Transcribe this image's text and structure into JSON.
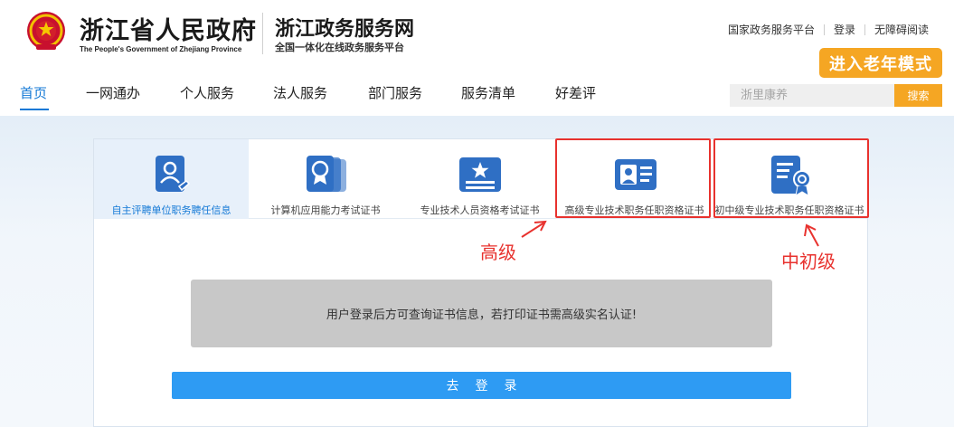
{
  "header": {
    "gov_name": "浙江省人民政府",
    "gov_name_en": "The People's Government of Zhejiang Province",
    "site_name": "浙江政务服务网",
    "site_subtitle": "全国一体化在线政务服务平台",
    "emblem_icon": "national-emblem-icon",
    "top_links": [
      "国家政务服务平台",
      "登录",
      "无障碍阅读"
    ],
    "elder_mode_label": "进入老年模式"
  },
  "nav": {
    "items": [
      "首页",
      "一网通办",
      "个人服务",
      "法人服务",
      "部门服务",
      "服务清单",
      "好差评"
    ],
    "active_index": 0
  },
  "search": {
    "placeholder": "浙里康养",
    "button_label": "搜索"
  },
  "tabs": [
    {
      "label": "自主评聘单位职务聘任信息",
      "icon": "user-document-icon",
      "active": true
    },
    {
      "label": "计算机应用能力考试证书",
      "icon": "certificate-badge-icon",
      "active": false
    },
    {
      "label": "专业技术人员资格考试证书",
      "icon": "star-card-icon",
      "active": false
    },
    {
      "label": "高级专业技术职务任职资格证书",
      "icon": "id-card-icon",
      "active": false
    },
    {
      "label": "初中级专业技术职务任职资格证书",
      "icon": "seal-document-icon",
      "active": false
    }
  ],
  "notice_text": "用户登录后方可查询证书信息，若打印证书需高级实名认证!",
  "login_button_label": "去登录",
  "annotations": {
    "senior_label": "高级",
    "junior_label": "中初级"
  },
  "colors": {
    "primary_blue": "#1479d6",
    "icon_blue": "#2f6fc4",
    "orange": "#f5a623",
    "login_blue": "#2e9bf3",
    "annotation_red": "#e8322e"
  }
}
